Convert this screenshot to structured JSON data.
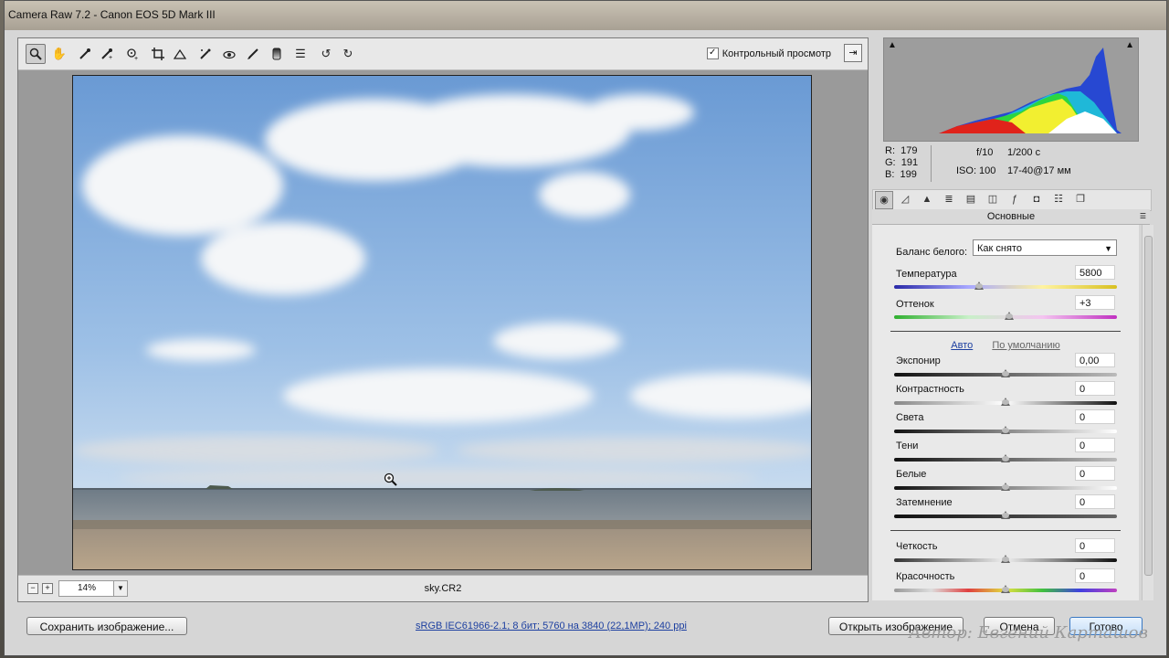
{
  "window": {
    "title": "Camera Raw 7.2  -  Canon EOS 5D Mark III"
  },
  "toolbar": {
    "tools": [
      "zoom-icon",
      "hand-icon",
      "white-balance-icon",
      "color-sampler-icon",
      "target-adjust-icon",
      "crop-icon",
      "straighten-icon",
      "spot-removal-icon",
      "red-eye-icon",
      "adjustment-brush-icon",
      "graduated-filter-icon",
      "preferences-icon",
      "rotate-ccw-icon",
      "rotate-cw-icon"
    ],
    "preview_label": "Контрольный просмотр",
    "preview_checked": true
  },
  "status": {
    "zoom": "14%",
    "filename": "sky.CR2"
  },
  "histogram": {
    "r_label": "R:",
    "r": "179",
    "g_label": "G:",
    "g": "191",
    "b_label": "B:",
    "b": "199"
  },
  "exif": {
    "aperture": "f/10",
    "shutter": "1/200 с",
    "iso": "ISO: 100",
    "lens": "17-40@17 мм"
  },
  "panel": {
    "tabs": [
      "basic-icon",
      "tone-curve-icon",
      "detail-icon",
      "hsl-icon",
      "split-toning-icon",
      "lens-correction-icon",
      "effects-icon",
      "camera-calibration-icon",
      "presets-icon",
      "snapshots-icon"
    ],
    "section_title": "Основные",
    "wb_label": "Баланс белого:",
    "wb_value": "Как снято",
    "temperature_label": "Температура",
    "temperature_value": "5800",
    "tint_label": "Оттенок",
    "tint_value": "+3",
    "auto_link": "Авто",
    "default_link": "По умолчанию",
    "sliders": [
      {
        "label": "Экспонир",
        "value": "0,00"
      },
      {
        "label": "Контрастность",
        "value": "0"
      },
      {
        "label": "Света",
        "value": "0"
      },
      {
        "label": "Тени",
        "value": "0"
      },
      {
        "label": "Белые",
        "value": "0"
      },
      {
        "label": "Затемнение",
        "value": "0"
      }
    ],
    "clarity_label": "Четкость",
    "clarity_value": "0",
    "vibrance_label": "Красочность",
    "vibrance_value": "0"
  },
  "footer": {
    "save_label": "Сохранить изображение...",
    "workflow_link": "sRGB IEC61966-2.1; 8 бит; 5760 на 3840 (22,1МР); 240 ppi",
    "open_label": "Открыть изображение",
    "cancel_label": "Отмена",
    "done_label": "Готово",
    "watermark": "Автор: Евгений Карташов"
  }
}
